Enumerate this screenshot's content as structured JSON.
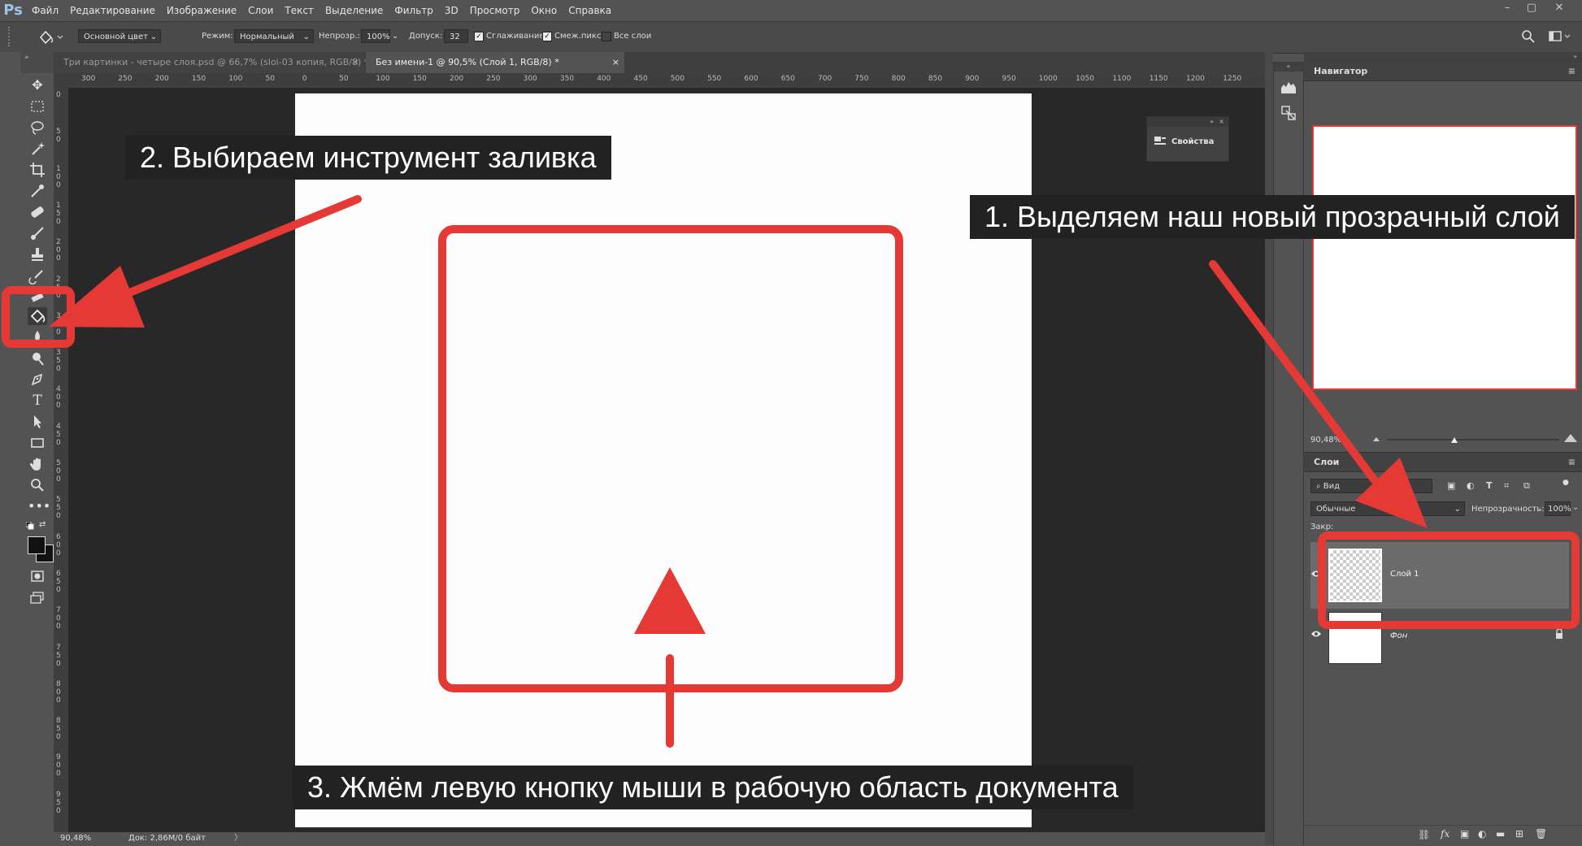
{
  "app": {
    "logo": "Ps"
  },
  "menu": [
    "Файл",
    "Редактирование",
    "Изображение",
    "Слои",
    "Текст",
    "Выделение",
    "Фильтр",
    "3D",
    "Просмотр",
    "Окно",
    "Справка"
  ],
  "window_controls": [
    "–",
    "▢",
    "✕"
  ],
  "options": {
    "fill_source": "Основной цвет",
    "mode_label": "Режим:",
    "mode_value": "Нормальный",
    "opacity_label": "Непрозр.:",
    "opacity_value": "100%",
    "tolerance_label": "Допуск:",
    "tolerance_value": "32",
    "anti_alias_label": "Сглаживание",
    "contiguous_label": "Смеж.пикс",
    "all_layers_label": "Все слои"
  },
  "tabs": [
    {
      "label": "Три картинки - четыре слоя.psd @ 66,7% (sloi-03 копия, RGB/8) *",
      "close": "×"
    },
    {
      "label": "Без имени-1 @ 90,5% (Слой 1, RGB/8) *",
      "close": "×"
    }
  ],
  "hruler_labels": [
    "300",
    "250",
    "200",
    "150",
    "100",
    "50",
    "0",
    "50",
    "100",
    "150",
    "200",
    "250",
    "300",
    "350",
    "400",
    "450",
    "500",
    "550",
    "600",
    "650",
    "700",
    "750",
    "800",
    "850",
    "900",
    "950",
    "1000",
    "1050",
    "1100",
    "1150",
    "1200",
    "1250"
  ],
  "vruler_labels": [
    "0",
    "50",
    "100",
    "150",
    "200",
    "250",
    "300",
    "350",
    "400",
    "450",
    "500",
    "550",
    "600",
    "650",
    "700",
    "750",
    "800",
    "850",
    "900",
    "950"
  ],
  "properties_panel": {
    "label": "Свойства"
  },
  "navigator": {
    "title": "Навигатор",
    "zoom": "90,48%"
  },
  "layers": {
    "title": "Слои",
    "search_placeholder": "Вид",
    "blend_mode": "Обычные",
    "opacity_label": "Непрозрачность:",
    "opacity_value": "100%",
    "lock_label": "Закр:",
    "items": [
      {
        "name": "Слой 1",
        "selected": true,
        "visible": true,
        "thumbnail": "transparent"
      },
      {
        "name": "Фон",
        "selected": false,
        "visible": true,
        "thumbnail": "white",
        "locked": true
      }
    ]
  },
  "status": {
    "zoom": "90,48%",
    "doc_info": "Док: 2,86M/0 байт"
  },
  "annotations": {
    "step1": "1. Выделяем наш новый прозрачный слой",
    "step2": "2. Выбираем инструмент заливка",
    "step3": "3. Жмём левую кнопку мыши в рабочую область документа"
  },
  "colors": {
    "accent_red": "#e53935",
    "ui_dark": "#535353",
    "workspace": "#282828"
  }
}
